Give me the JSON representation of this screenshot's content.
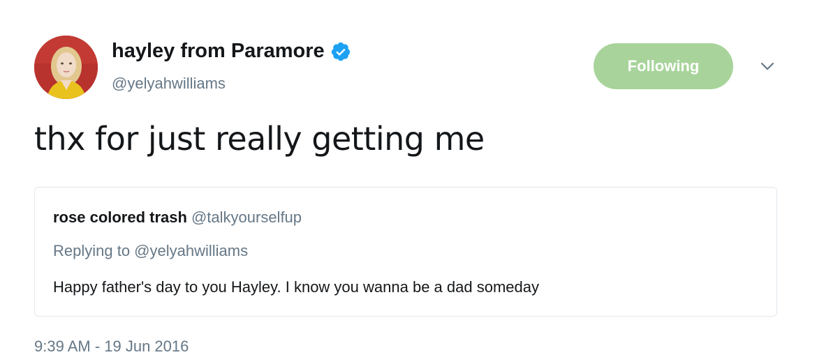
{
  "author": {
    "display_name": "hayley from Paramore",
    "handle": "@yelyahwilliams",
    "verified": true,
    "verified_icon": "verified-badge-icon",
    "avatar": "profile-photo"
  },
  "follow_button": {
    "label": "Following",
    "color": "#a8d49b"
  },
  "menu_icon": "chevron-down-icon",
  "tweet": {
    "text": "thx for just really getting me",
    "timestamp": "9:39 AM - 19 Jun 2016"
  },
  "quoted_tweet": {
    "display_name": "rose colored trash",
    "handle": "@talkyourselfup",
    "replying_to": "Replying to @yelyahwilliams",
    "text": "Happy father's day to you Hayley. I know you wanna be a dad someday"
  },
  "colors": {
    "text_primary": "#14171a",
    "text_secondary": "#657786",
    "verified_blue": "#1da1f2",
    "border": "#e1e8ed"
  }
}
